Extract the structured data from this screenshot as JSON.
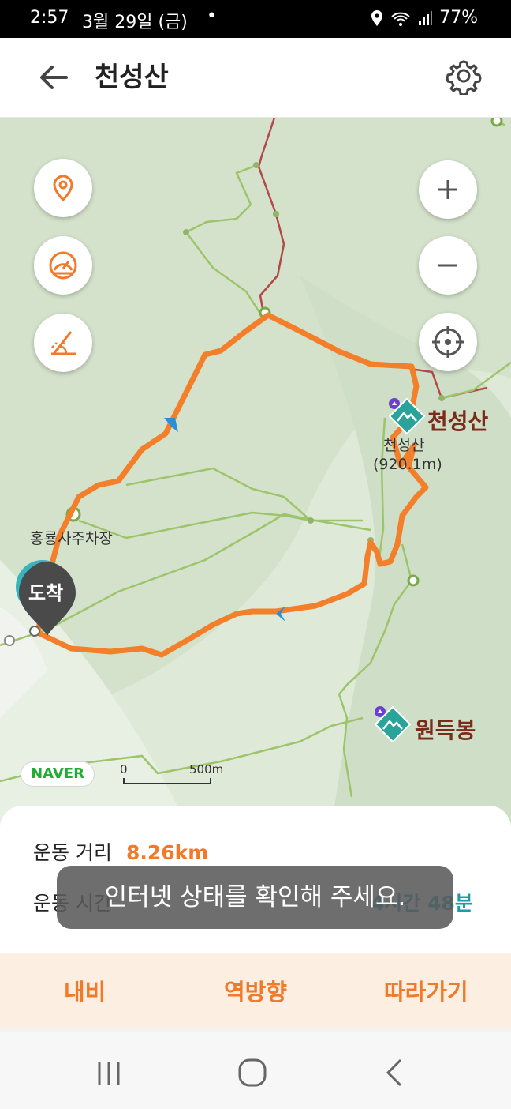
{
  "status": {
    "time": "2:57",
    "date": "3월 29일 (금)",
    "dot": "•",
    "battery": "77%"
  },
  "header": {
    "title": "천성산",
    "back_icon": "back-arrow-icon",
    "settings_icon": "gear-icon"
  },
  "map": {
    "left_buttons": [
      "location-pin-icon",
      "speedometer-icon",
      "slope-icon"
    ],
    "right_buttons": [
      "zoom-in-icon",
      "zoom-out-icon",
      "crosshair-icon"
    ],
    "peaks": [
      {
        "name": "천성산",
        "sub": "천성산",
        "elev": "(920.1m)"
      },
      {
        "name": "원득봉"
      }
    ],
    "parking_label": "홍룡사주차장",
    "destination_label": "도착",
    "naver_logo": "NAVER",
    "scale": {
      "start": "0",
      "end": "500m"
    },
    "colors": {
      "route": "#f47f2a",
      "trail": "#9cc46b",
      "road": "#b24848",
      "arrow": "#2a8fd6"
    }
  },
  "summary": {
    "distance_label": "운동 거리",
    "distance_value": "8.26km",
    "time_label": "운동 시간",
    "time_value_partial": "4시간 48분"
  },
  "toast": "인터넷 상태를 확인해 주세요.",
  "actions": [
    "내비",
    "역방향",
    "따라가기"
  ],
  "navbar": [
    "recent-apps-icon",
    "home-icon",
    "back-nav-icon"
  ]
}
